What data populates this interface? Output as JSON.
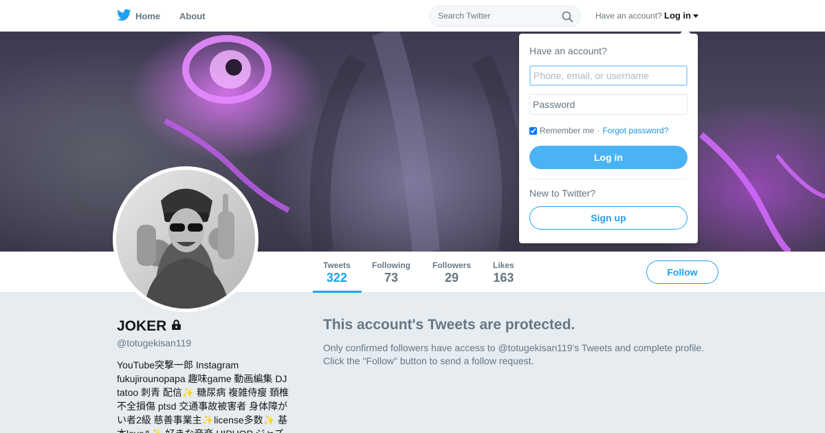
{
  "nav": {
    "home_label": "Home",
    "about_label": "About",
    "search_placeholder": "Search Twitter",
    "have_account": "Have an account?",
    "login_label": "Log in"
  },
  "profile": {
    "name": "JOKER",
    "screen_name": "@totugekisan119",
    "bio": "YouTube突撃一郎 Instagram fukujirounopapa 趣味game 動画編集 DJ tatoo 刺青 配信✨ 糖尿病 複雑侍瘦 頚椎不全損傷 ptsd 交通事故被害者 身体障がい者2級 慈善事業主✨license多数✨ 基本love&✨ 好きな音楽 HIPHOP ジャズ"
  },
  "stats": [
    {
      "label": "Tweets",
      "value": "322",
      "active": true
    },
    {
      "label": "Following",
      "value": "73",
      "active": false
    },
    {
      "label": "Followers",
      "value": "29",
      "active": false
    },
    {
      "label": "Likes",
      "value": "163",
      "active": false
    }
  ],
  "follow_label": "Follow",
  "protected": {
    "title": "This account's Tweets are protected.",
    "text": "Only confirmed followers have access to @totugekisan119's Tweets and complete profile. Click the \"Follow\" button to send a follow request."
  },
  "login_dropdown": {
    "title": "Have an account?",
    "username_placeholder": "Phone, email, or username",
    "password_placeholder": "Password",
    "remember_label": "Remember me",
    "separator": "·",
    "forgot_label": "Forgot password?",
    "login_button": "Log in",
    "new_label": "New to Twitter?",
    "signup_button": "Sign up"
  },
  "colors": {
    "accent": "#1da1f2",
    "login_button": "#4ab3f4",
    "background": "#e6ecf0"
  }
}
